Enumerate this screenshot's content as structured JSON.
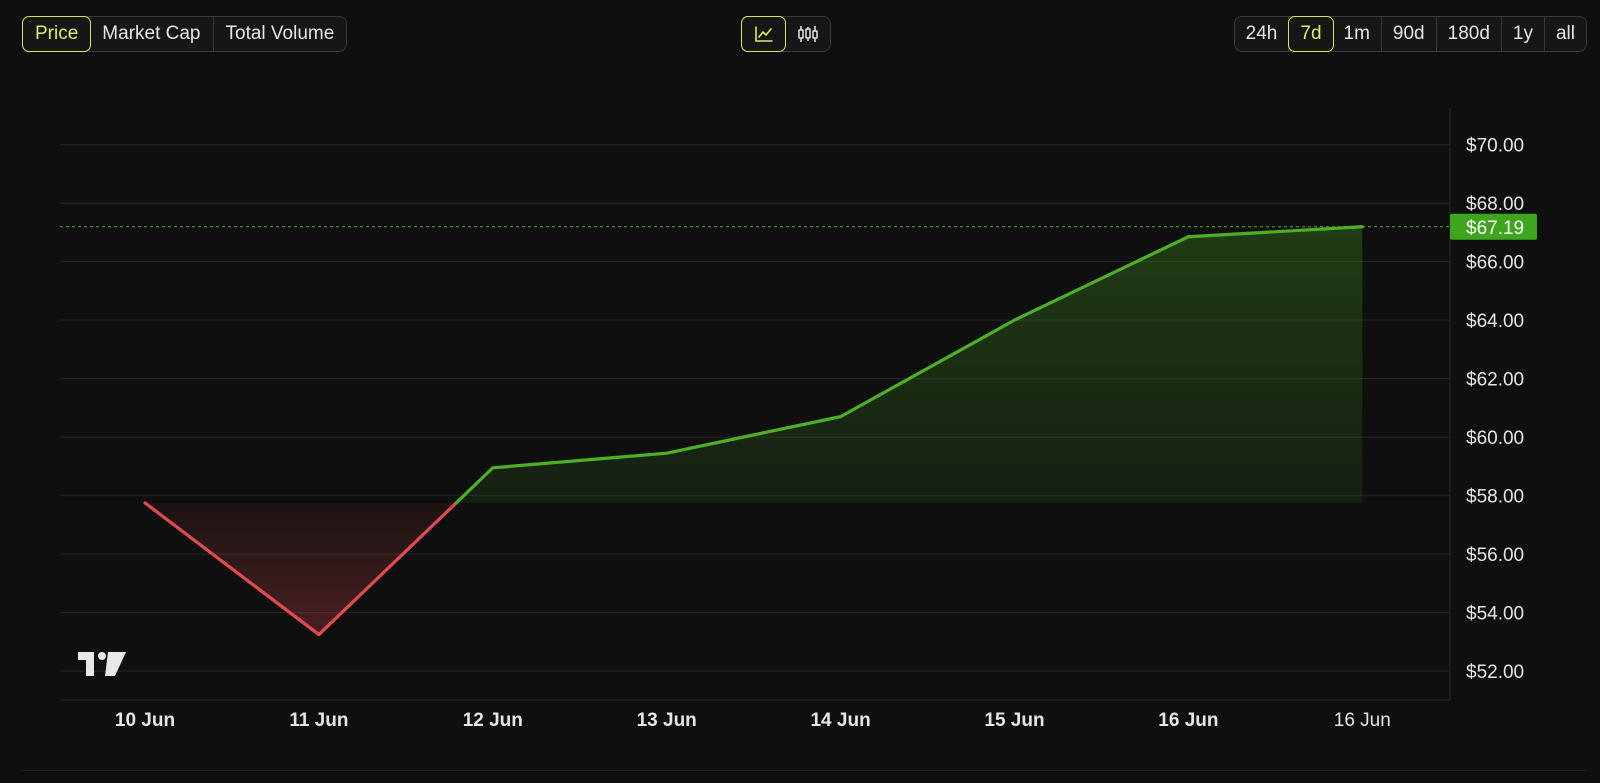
{
  "toolbar": {
    "metrics": [
      "Price",
      "Market Cap",
      "Total Volume"
    ],
    "active_metric": "Price",
    "chart_types": [
      {
        "icon": "line-chart-icon",
        "active": true
      },
      {
        "icon": "candlestick-chart-icon",
        "active": false
      }
    ],
    "ranges": [
      "24h",
      "7d",
      "1m",
      "90d",
      "180d",
      "1y",
      "all"
    ],
    "active_range": "7d"
  },
  "colors": {
    "background": "#0f0f0f",
    "accent": "#c8ec5a",
    "up": "#4caf24",
    "down": "#e34a4f",
    "grid": "#262626",
    "label_up_bg": "#3da51e"
  },
  "chart_data": {
    "type": "line",
    "x": [
      "10 Jun",
      "11 Jun",
      "12 Jun",
      "13 Jun",
      "14 Jun",
      "15 Jun",
      "16 Jun",
      "16 Jun"
    ],
    "x_label_bold": [
      true,
      true,
      true,
      true,
      true,
      true,
      true,
      false
    ],
    "values": [
      57.75,
      53.25,
      58.95,
      59.45,
      60.7,
      64.0,
      66.85,
      67.19
    ],
    "baseline": 57.75,
    "current_price_label": "$67.19",
    "y_ticks": [
      "$52.00",
      "$54.00",
      "$56.00",
      "$58.00",
      "$60.00",
      "$62.00",
      "$64.00",
      "$66.00",
      "$68.00",
      "$70.00"
    ],
    "y_tick_values": [
      52,
      54,
      56,
      58,
      60,
      62,
      64,
      66,
      68,
      70
    ],
    "ylim": [
      51.15,
      71.25
    ],
    "grid": true,
    "watermark": "TradingView logo"
  }
}
